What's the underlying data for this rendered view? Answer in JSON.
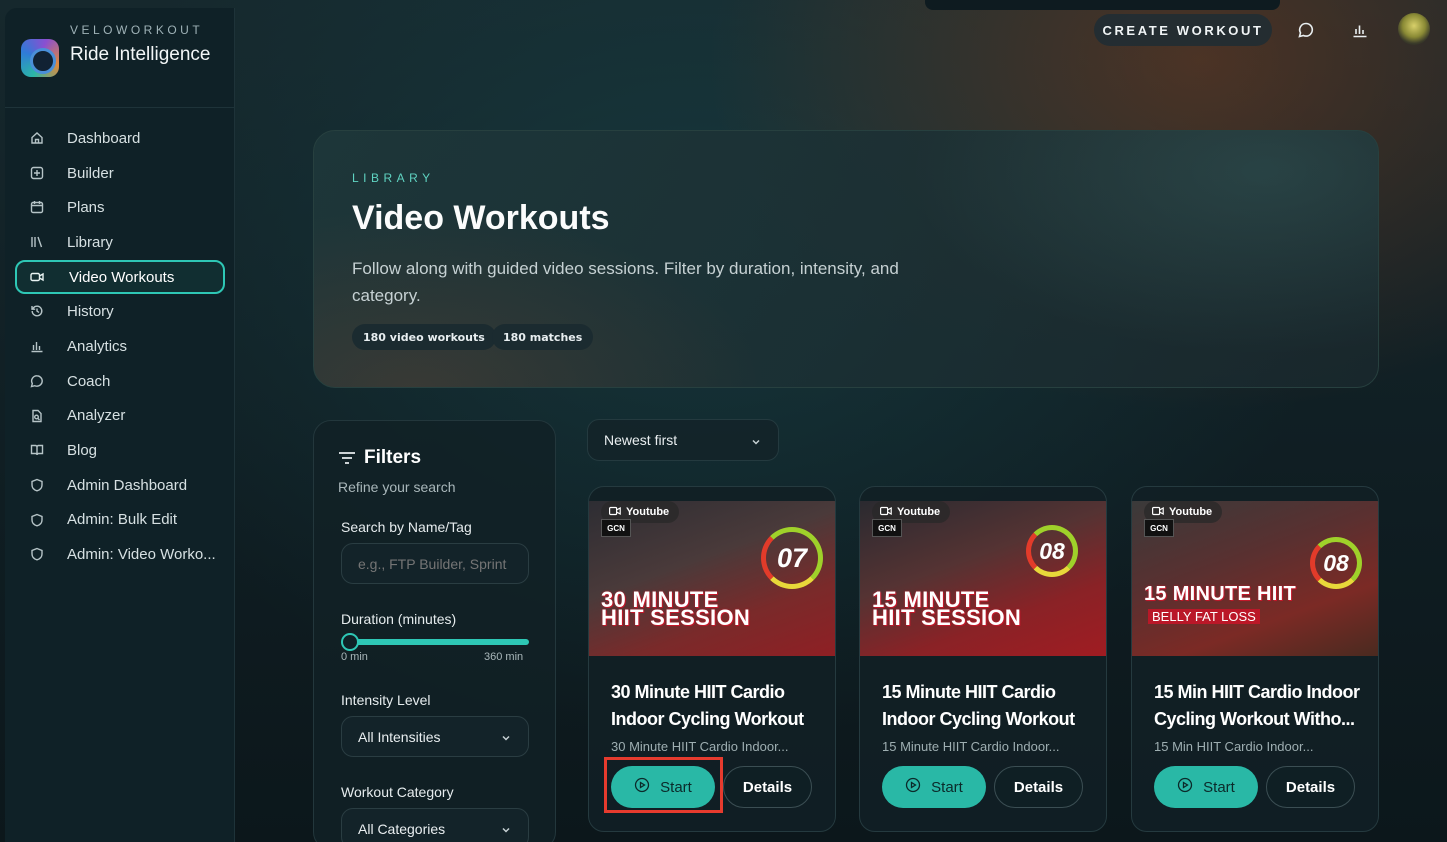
{
  "brand": {
    "sub": "VELOWORKOUT",
    "title": "Ride Intelligence"
  },
  "sidebar": {
    "items": [
      {
        "label": "Dashboard",
        "icon": "home-icon"
      },
      {
        "label": "Builder",
        "icon": "plus-square-icon"
      },
      {
        "label": "Plans",
        "icon": "calendar-icon"
      },
      {
        "label": "Library",
        "icon": "library-icon"
      },
      {
        "label": "Video Workouts",
        "icon": "video-icon",
        "active": true
      },
      {
        "label": "History",
        "icon": "history-icon"
      },
      {
        "label": "Analytics",
        "icon": "bar-chart-icon"
      },
      {
        "label": "Coach",
        "icon": "chat-icon"
      },
      {
        "label": "Analyzer",
        "icon": "file-analyze-icon"
      },
      {
        "label": "Blog",
        "icon": "book-icon"
      },
      {
        "label": "Admin Dashboard",
        "icon": "shield-icon"
      },
      {
        "label": "Admin: Bulk Edit",
        "icon": "shield-icon"
      },
      {
        "label": "Admin: Video Worko...",
        "icon": "shield-icon"
      }
    ]
  },
  "topbar": {
    "create_label": "CREATE WORKOUT"
  },
  "hero": {
    "eyebrow": "LIBRARY",
    "title": "Video Workouts",
    "description": "Follow along with guided video sessions. Filter by duration, intensity, and category.",
    "pill_total": "180 video workouts",
    "pill_matches": "180 matches"
  },
  "filters": {
    "title": "Filters",
    "subtitle": "Refine your search",
    "search_label": "Search by Name/Tag",
    "search_placeholder": "e.g., FTP Builder, Sprint",
    "duration_label": "Duration (minutes)",
    "duration_min": "0 min",
    "duration_max": "360 min",
    "intensity_label": "Intensity Level",
    "intensity_value": "All Intensities",
    "category_label": "Workout Category",
    "category_value": "All Categories"
  },
  "sort": {
    "value": "Newest first"
  },
  "cards": [
    {
      "source": "Youtube",
      "episode": "07",
      "thumb_line1": "30 MINUTE",
      "thumb_line2": "HIIT SESSION",
      "title": "30 Minute HIIT Cardio Indoor Cycling Workout ...",
      "desc": "30 Minute HIIT Cardio Indoor...",
      "start": "Start",
      "details": "Details"
    },
    {
      "source": "Youtube",
      "episode": "08",
      "thumb_line1": "15 MINUTE",
      "thumb_line2": "HIIT SESSION",
      "title": "15 Minute HIIT Cardio Indoor Cycling Workout ...",
      "desc": "15 Minute HIIT Cardio Indoor...",
      "start": "Start",
      "details": "Details"
    },
    {
      "source": "Youtube",
      "episode": "08",
      "thumb_line1": "15 MINUTE HIIT",
      "thumb_sub": "BELLY FAT LOSS",
      "title": "15 Min HIIT Cardio Indoor Cycling Workout Witho...",
      "desc": "15 Min HIIT Cardio Indoor...",
      "start": "Start",
      "details": "Details"
    }
  ],
  "colors": {
    "accent": "#2ec7b5",
    "highlight": "#e63b2e"
  }
}
